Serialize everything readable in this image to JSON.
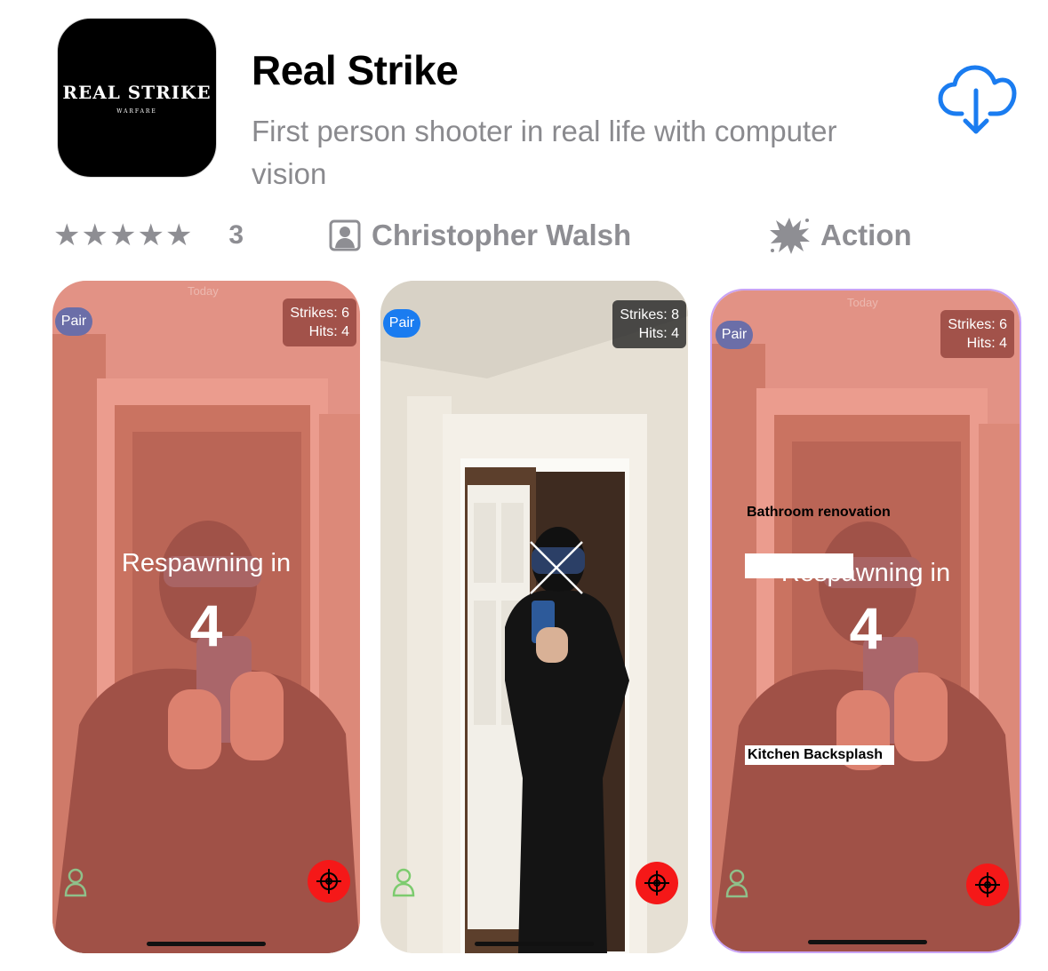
{
  "app": {
    "icon_text": "REAL STRIKE",
    "icon_subtext": "WARFARE",
    "title": "Real Strike",
    "subtitle": "First person shooter in real life with computer vision"
  },
  "meta": {
    "rating_stars": 5,
    "rating_count": "3",
    "developer": "Christopher Walsh",
    "category": "Action"
  },
  "icons": {
    "download": "cloud-download-icon",
    "developer": "person-square-icon",
    "category": "burst-icon"
  },
  "colors": {
    "accent": "#1a7cf0",
    "meta_gray": "#8e8e93",
    "respawn_tint": "#e86e60",
    "fire_red": "#f51818"
  },
  "screenshots": [
    {
      "pair_label": "Pair",
      "strikes": "Strikes: 6",
      "hits": "Hits: 4",
      "today": "Today",
      "respawn_text": "Respawning in",
      "respawn_count": "4"
    },
    {
      "pair_label": "Pair",
      "strikes": "Strikes: 8",
      "hits": "Hits: 4"
    },
    {
      "pair_label": "Pair",
      "strikes": "Strikes: 6",
      "hits": "Hits: 4",
      "today": "Today",
      "respawn_text": "Respawning in",
      "respawn_count": "4",
      "overlay_label_1": "Bathroom renovation",
      "overlay_label_2": "Kitchen Backsplash"
    }
  ]
}
